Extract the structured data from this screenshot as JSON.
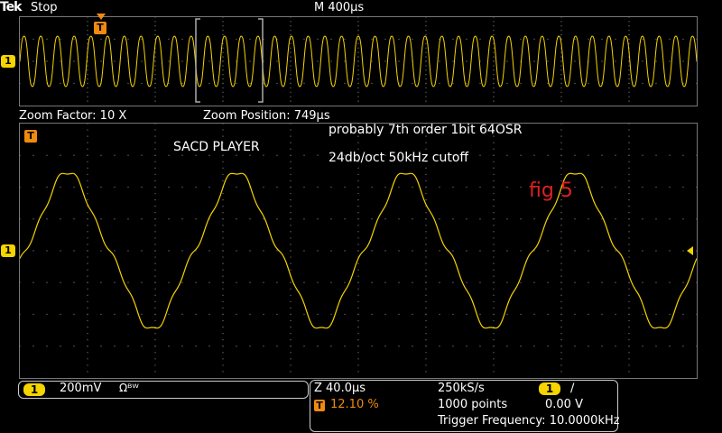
{
  "header": {
    "brand": "Tek",
    "acq_state": "Stop",
    "timebase": "M 400µs"
  },
  "overview": {
    "channel_marker": "1",
    "trigger_marker": "T"
  },
  "zoom_info": {
    "factor": "Zoom Factor: 10 X",
    "position": "Zoom Position: 749µs"
  },
  "zoom_window": {
    "channel_marker": "1",
    "trigger_marker": "T"
  },
  "annotations": {
    "player": "SACD PLAYER",
    "line1": "probably 7th order 1bit  64OSR",
    "line2": "24db/oct 50kHz cutoff",
    "fig": "fig 5"
  },
  "channel_panel": {
    "channel": "1",
    "volts_div": "200mV",
    "coupling": "Ωᴮᵂ"
  },
  "acq_panel": {
    "zoom_timebase": "Z 40.0µs",
    "trigger_icon": "T",
    "trigger_pos": "12.10 %",
    "sample_rate": "250kS/s",
    "record_length": "1000 points",
    "trigger_channel": "1",
    "trigger_slope": "∕",
    "trigger_level": "0.00 V",
    "trigger_frequency": "Trigger Frequency: 10.0000kHz"
  },
  "colors": {
    "trace": "#f5d400",
    "trigger": "#f08a10",
    "annotation_fig": "#e02020",
    "grid": "#666666"
  }
}
